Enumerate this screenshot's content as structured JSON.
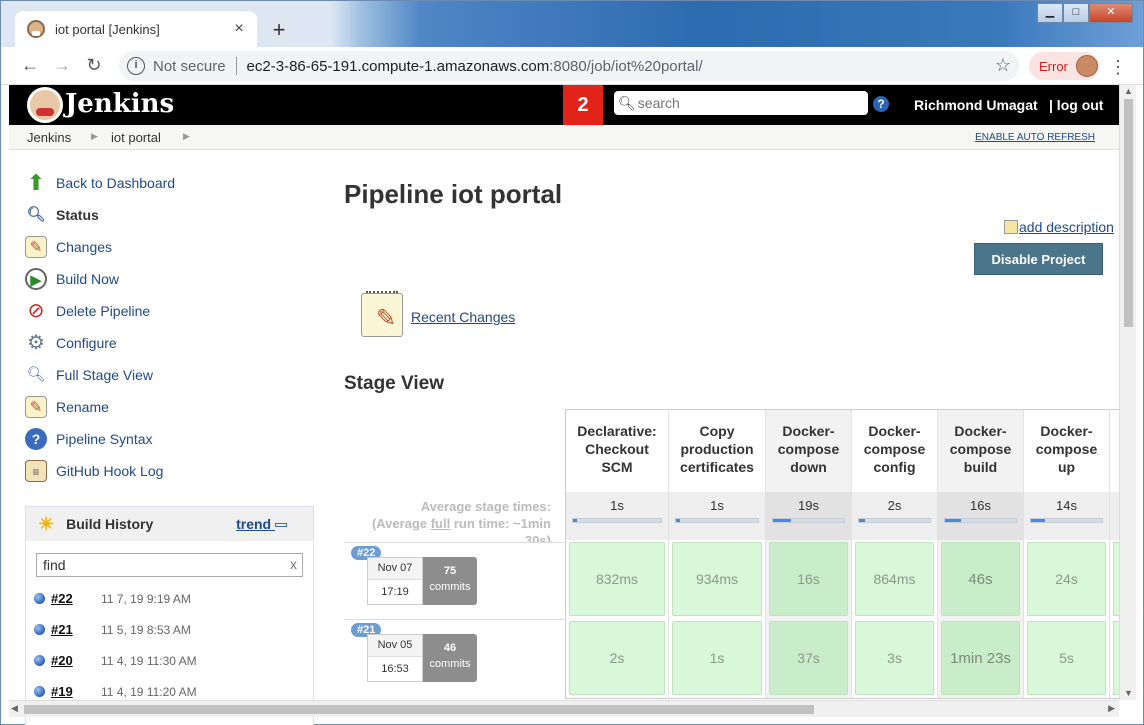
{
  "browser": {
    "tab_title": "iot portal [Jenkins]",
    "not_secure": "Not secure",
    "url_host": "ec2-3-86-65-191.compute-1.amazonaws.com",
    "url_path": ":8080/job/iot%20portal/",
    "error_label": "Error"
  },
  "header": {
    "brand": "Jenkins",
    "notifications": "2",
    "search_placeholder": "search",
    "user": "Richmond Umagat",
    "logout": "| log out"
  },
  "breadcrumb": {
    "items": [
      "Jenkins",
      "iot portal"
    ],
    "auto_refresh": "ENABLE AUTO REFRESH"
  },
  "sidebar": {
    "items": [
      {
        "label": "Back to Dashboard",
        "icon": "up-arrow-icon"
      },
      {
        "label": "Status",
        "icon": "magnifier-icon"
      },
      {
        "label": "Changes",
        "icon": "notepad-icon"
      },
      {
        "label": "Build Now",
        "icon": "clock-play-icon"
      },
      {
        "label": "Delete Pipeline",
        "icon": "no-entry-icon"
      },
      {
        "label": "Configure",
        "icon": "gear-icon"
      },
      {
        "label": "Full Stage View",
        "icon": "magnifier-icon"
      },
      {
        "label": "Rename",
        "icon": "notepad-icon"
      },
      {
        "label": "Pipeline Syntax",
        "icon": "help-icon"
      },
      {
        "label": "GitHub Hook Log",
        "icon": "clipboard-icon"
      }
    ]
  },
  "build_history": {
    "title": "Build History",
    "trend": "trend",
    "filter_value": "find",
    "clear": "x",
    "builds": [
      {
        "num": "#22",
        "date": "11 7, 19 9:19 AM"
      },
      {
        "num": "#21",
        "date": "11 5, 19 8:53 AM"
      },
      {
        "num": "#20",
        "date": "11 4, 19 11:30 AM"
      },
      {
        "num": "#19",
        "date": "11 4, 19 11:20 AM"
      }
    ]
  },
  "main": {
    "title": "Pipeline iot portal",
    "add_description": "add description",
    "disable_button": "Disable Project",
    "recent_changes": "Recent Changes",
    "stage_view_title": "Stage View",
    "avg_line1": "Average stage times:",
    "avg_line2_pre": "(Average ",
    "avg_line2_full": "full",
    "avg_line2_post": " run time: ~1min",
    "avg_line3": "30s)"
  },
  "stage_view": {
    "stages": [
      {
        "name": "Declarative: Checkout SCM",
        "avg": "1s",
        "progress": 0.05
      },
      {
        "name": "Copy production certificates",
        "avg": "1s",
        "progress": 0.05
      },
      {
        "name": "Docker-compose down",
        "avg": "19s",
        "progress": 0.25
      },
      {
        "name": "Docker-compose config",
        "avg": "2s",
        "progress": 0.08
      },
      {
        "name": "Docker-compose build",
        "avg": "16s",
        "progress": 0.22
      },
      {
        "name": "Docker-compose up",
        "avg": "14s",
        "progress": 0.2
      }
    ],
    "runs": [
      {
        "id": "#22",
        "month_day": "Nov 07",
        "time": "17:19",
        "commits": "75",
        "commits_label": "commits",
        "durations": [
          "832ms",
          "934ms",
          "16s",
          "864ms",
          "46s",
          "24s"
        ]
      },
      {
        "id": "#21",
        "month_day": "Nov 05",
        "time": "16:53",
        "commits": "46",
        "commits_label": "commits",
        "durations": [
          "2s",
          "1s",
          "37s",
          "3s",
          "1min 23s",
          "5s"
        ]
      }
    ]
  },
  "colors": {
    "link": "#204a87",
    "stage_success": "#d9f7d9",
    "stage_success_dark": "#c9ecc9",
    "header_bg": "#000000",
    "badge": "#e2231a",
    "button": "#4b758b"
  }
}
